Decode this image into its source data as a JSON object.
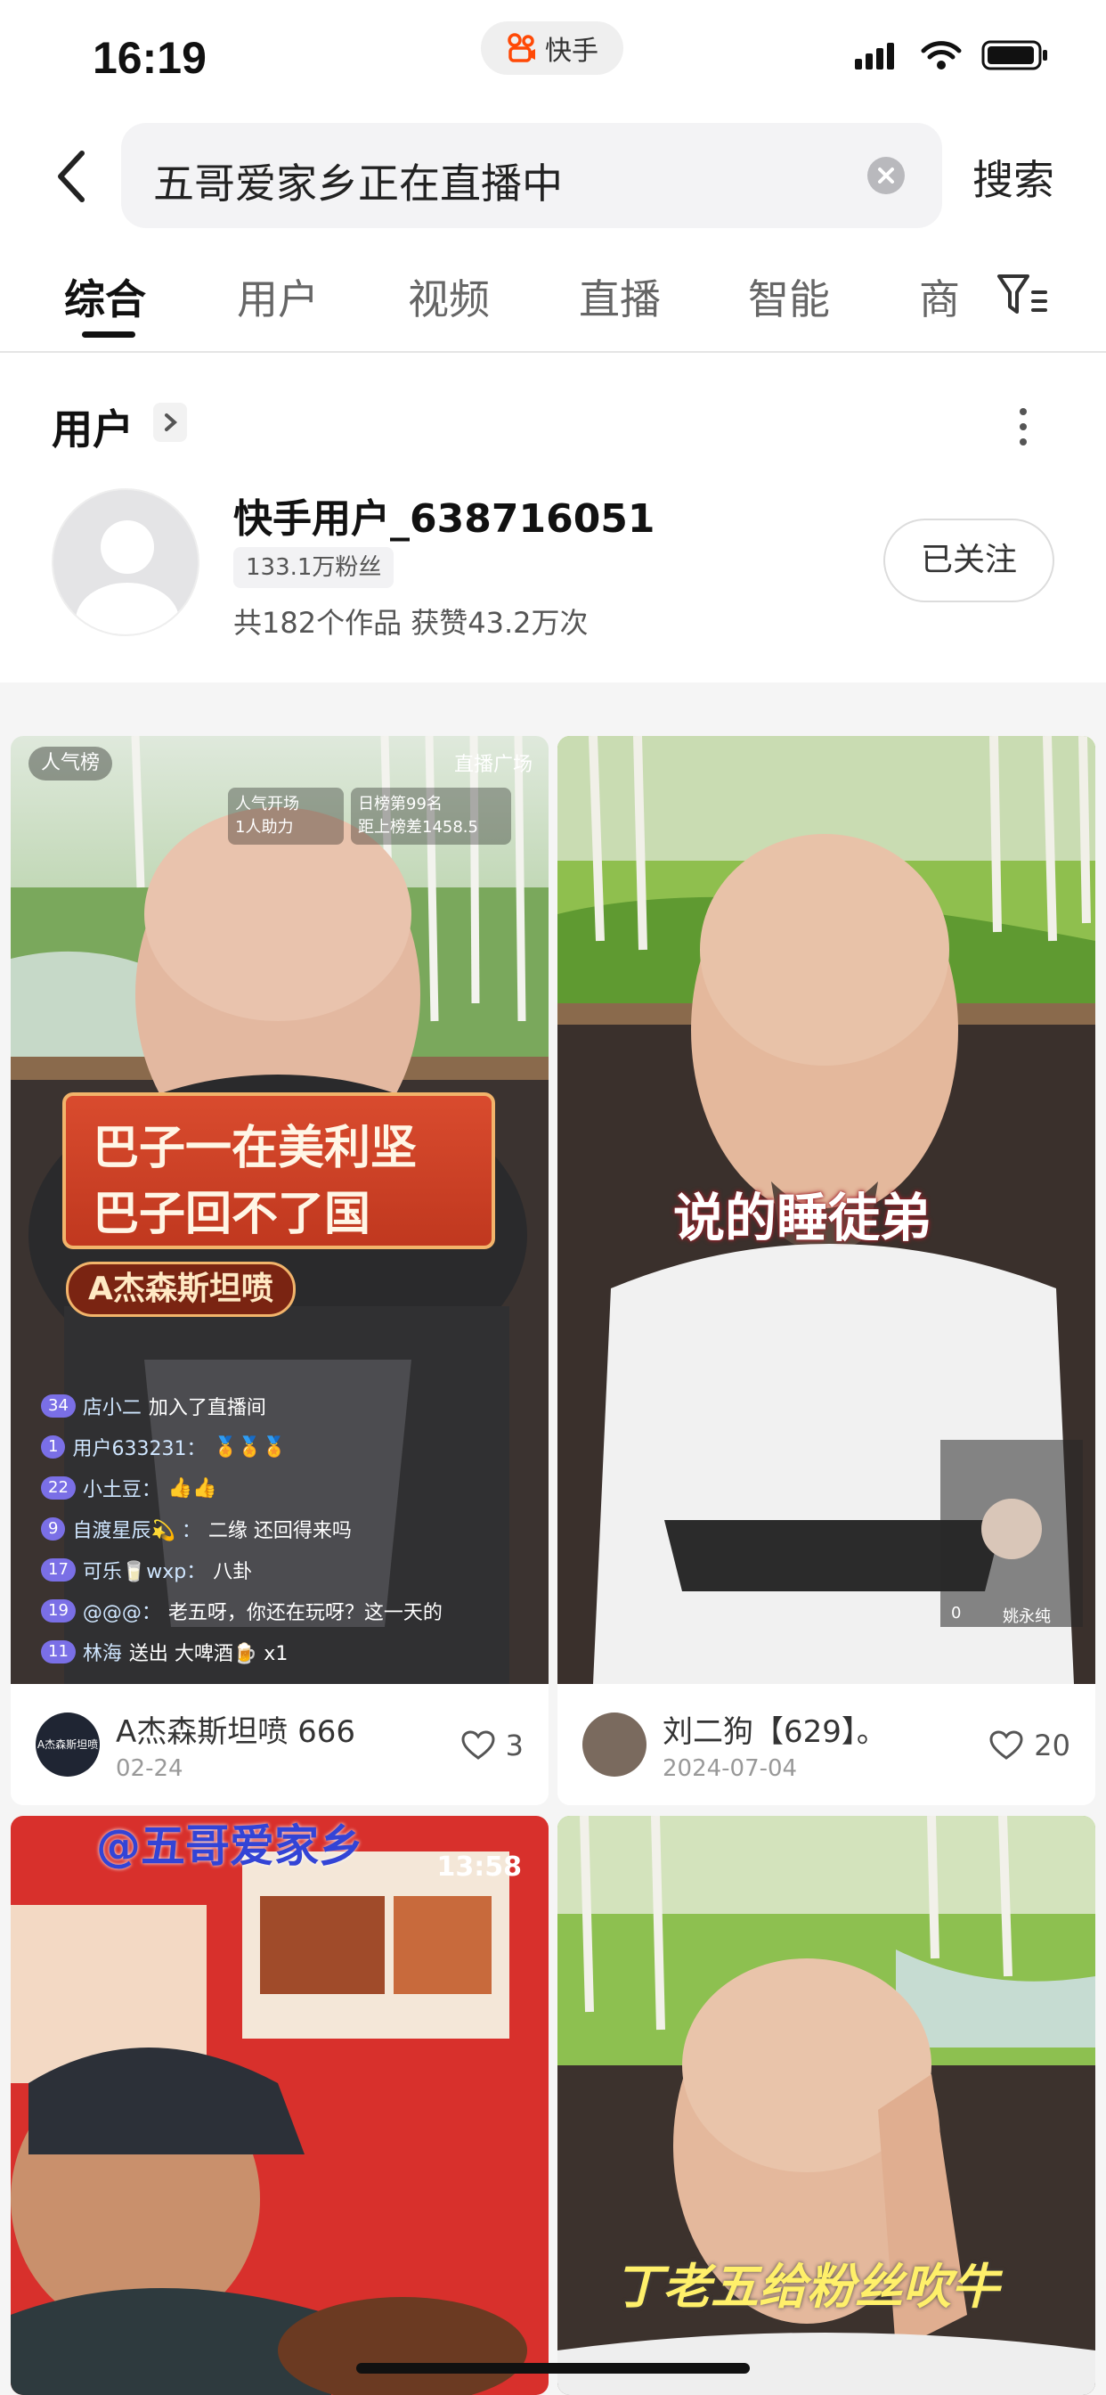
{
  "status_bar": {
    "time": "16:19",
    "app_name": "快手"
  },
  "search": {
    "query": "五哥爱家乡正在直播中",
    "button": "搜索"
  },
  "tabs": [
    {
      "label": "综合",
      "active": true
    },
    {
      "label": "用户"
    },
    {
      "label": "视频"
    },
    {
      "label": "直播"
    },
    {
      "label": "智能"
    },
    {
      "label": "商"
    }
  ],
  "user_section": {
    "title": "用户",
    "user": {
      "name": "快手用户_638716051",
      "fans": "133.1万粉丝",
      "stats": "共182个作品 获赞43.2万次",
      "follow_label": "已关注"
    }
  },
  "videos": [
    {
      "badge": "人气榜",
      "top_right": "直播广场",
      "info_left_1": "人气开场",
      "info_left_2": "1人助力",
      "info_right_1": "日榜第99名",
      "info_right_2": "距上榜差1458.5",
      "caption_lines": [
        "巴子一在美利坚",
        "巴子回不了国"
      ],
      "caption_tag": "A杰森斯坦喷",
      "chat": [
        {
          "level": "34",
          "name": "店小二",
          "text": "加入了直播间"
        },
        {
          "level": "1",
          "name": "用户633231：",
          "text": "🏅🏅🏅"
        },
        {
          "level": "22",
          "name": "小土豆：",
          "text": "👍👍"
        },
        {
          "level": "9",
          "name": "自渡星辰💫 ：",
          "text": "二缘 还回得来吗"
        },
        {
          "level": "17",
          "name": "可乐🥛wxp：",
          "text": "八卦"
        },
        {
          "level": "19",
          "name": "@@@：",
          "text": "老五呀，你还在玩呀？这一天的"
        },
        {
          "level": "11",
          "name": "林海",
          "text": "送出 大啤酒🍺 x1"
        }
      ],
      "author": "A杰森斯坦喷 666",
      "date": "02-24",
      "likes": "3",
      "author_avatar_text": "A杰森斯坦喷"
    },
    {
      "caption": "说的睡徒弟",
      "pip_left": "0",
      "pip_right": "姚永纯",
      "author": "刘二狗【629】。",
      "date": "2024-07-04",
      "likes": "20"
    },
    {
      "top_caption": "@五哥爱家乡",
      "timestamp": "13:58"
    },
    {
      "caption": "丁老五给粉丝吹牛"
    }
  ]
}
